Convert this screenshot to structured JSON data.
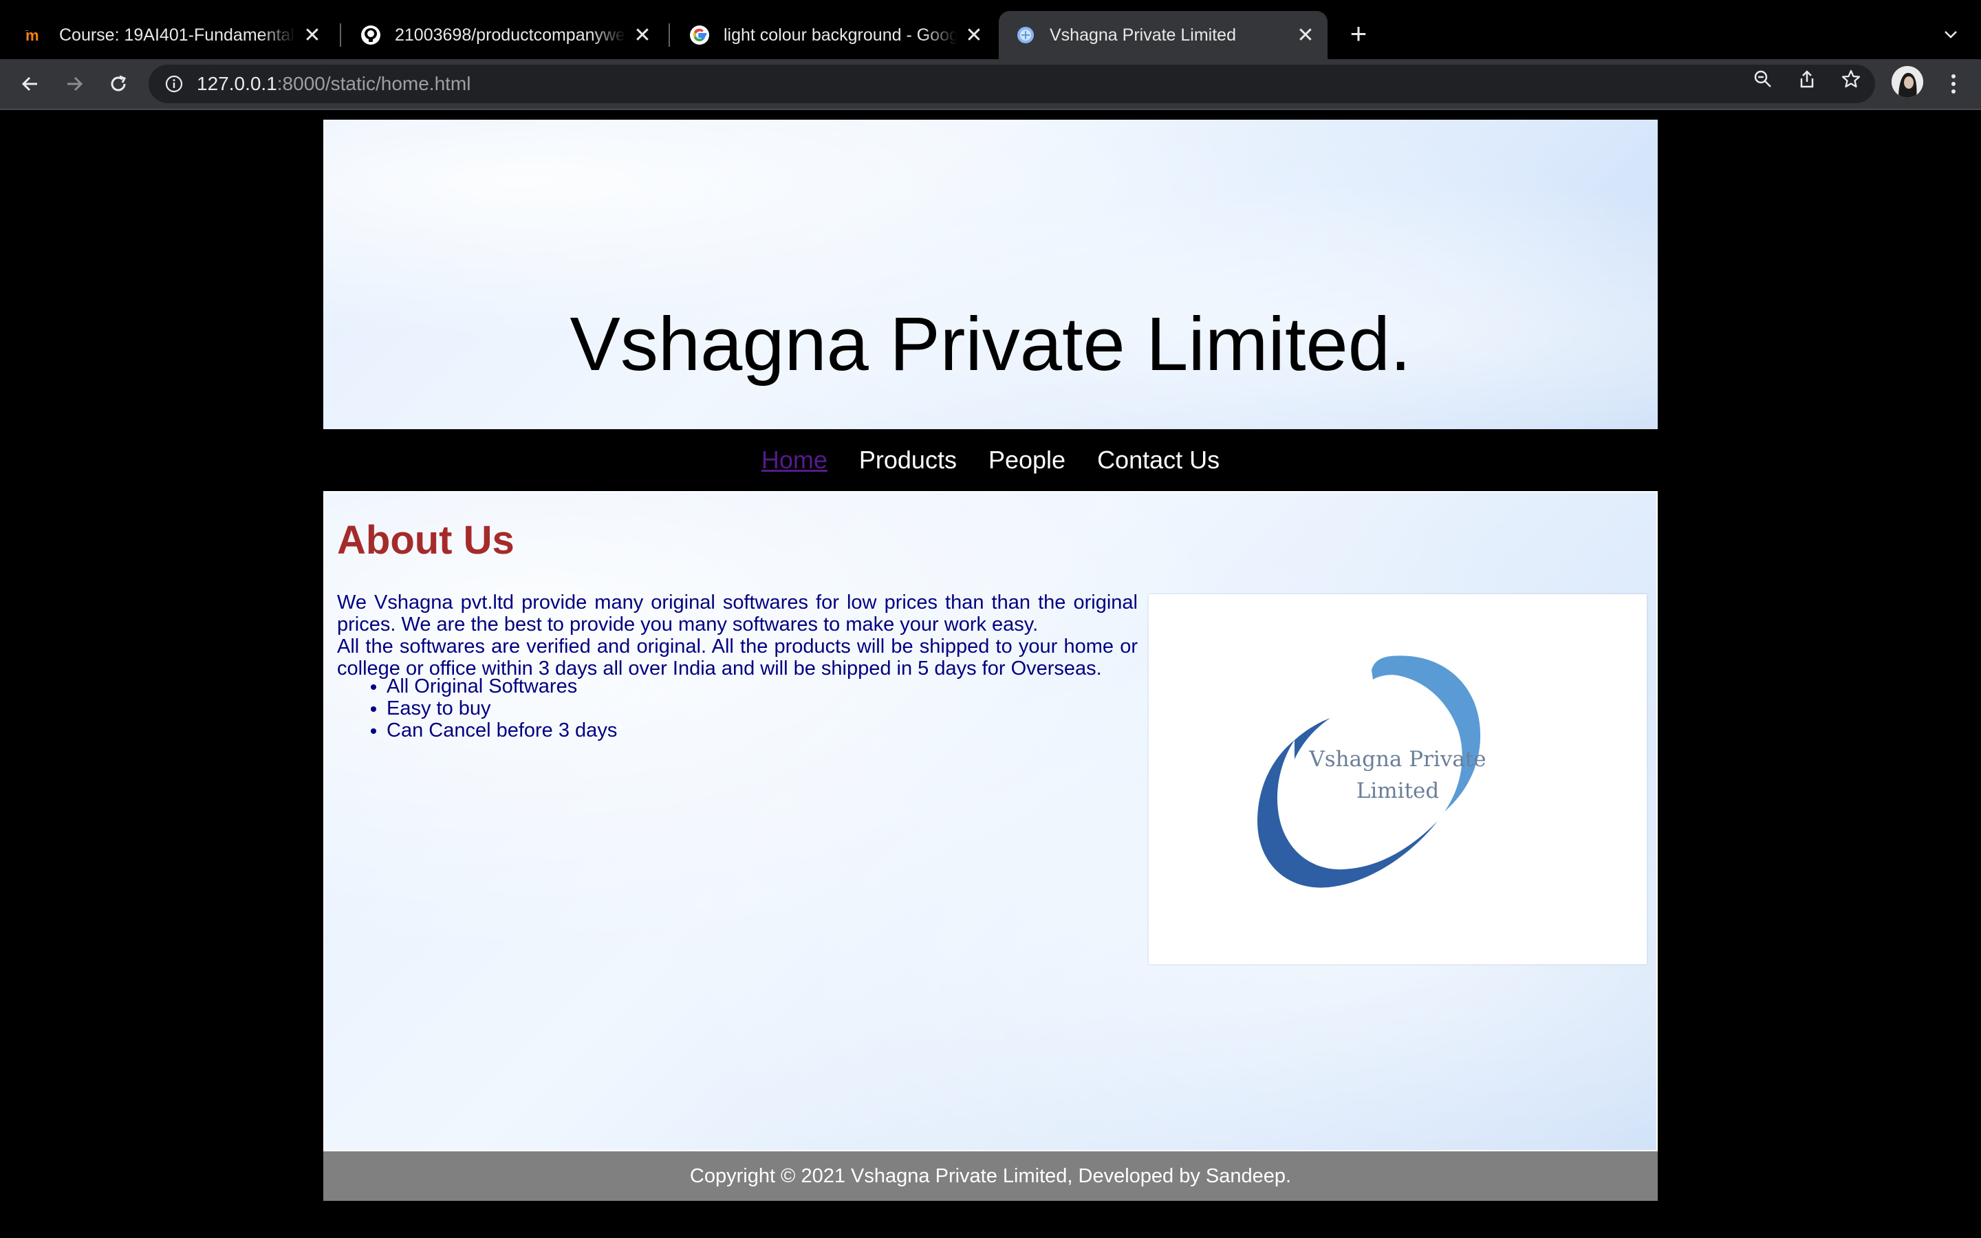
{
  "browser": {
    "tabs": [
      {
        "title": "Course: 19AI401-Fundamentals of Web Application Development",
        "favicon": "moodle-icon",
        "active": false
      },
      {
        "title": "21003698/productcompanywebsite",
        "favicon": "github-icon",
        "active": false
      },
      {
        "title": "light colour background - Google Search",
        "favicon": "google-icon",
        "active": false
      },
      {
        "title": "Vshagna Private Limited",
        "favicon": "globe-icon",
        "active": true
      }
    ],
    "url_host": "127.0.0.1",
    "url_rest": ":8000/static/home.html"
  },
  "page": {
    "header_title": "Vshagna Private Limited.",
    "nav": [
      "Home",
      "Products",
      "People",
      "Contact Us"
    ],
    "about_heading": "About Us",
    "paragraph_1": "We Vshagna pvt.ltd provide many original softwares for low prices than than the original prices. We are the best to provide you many softwares to make your work easy.",
    "paragraph_2": "All the softwares are verified and original. All the products will be shipped to your home or college or office within 3 days all over India and will be shipped in 5 days for Overseas.",
    "features": [
      "All Original Softwares",
      "Easy to buy",
      "Can Cancel before 3 days"
    ],
    "logo_text_line1": "Vshagna Private",
    "logo_text_line2": "Limited",
    "footer": "Copyright © 2021 Vshagna Private Limited, Developed by Sandeep."
  },
  "colors": {
    "heading": "#a52a2a",
    "body_text": "#000080",
    "visited_link": "#551a8b",
    "footer_bg": "#808080",
    "logo_blue_light": "#5b9bd5",
    "logo_blue_dark": "#2e5ea3"
  }
}
